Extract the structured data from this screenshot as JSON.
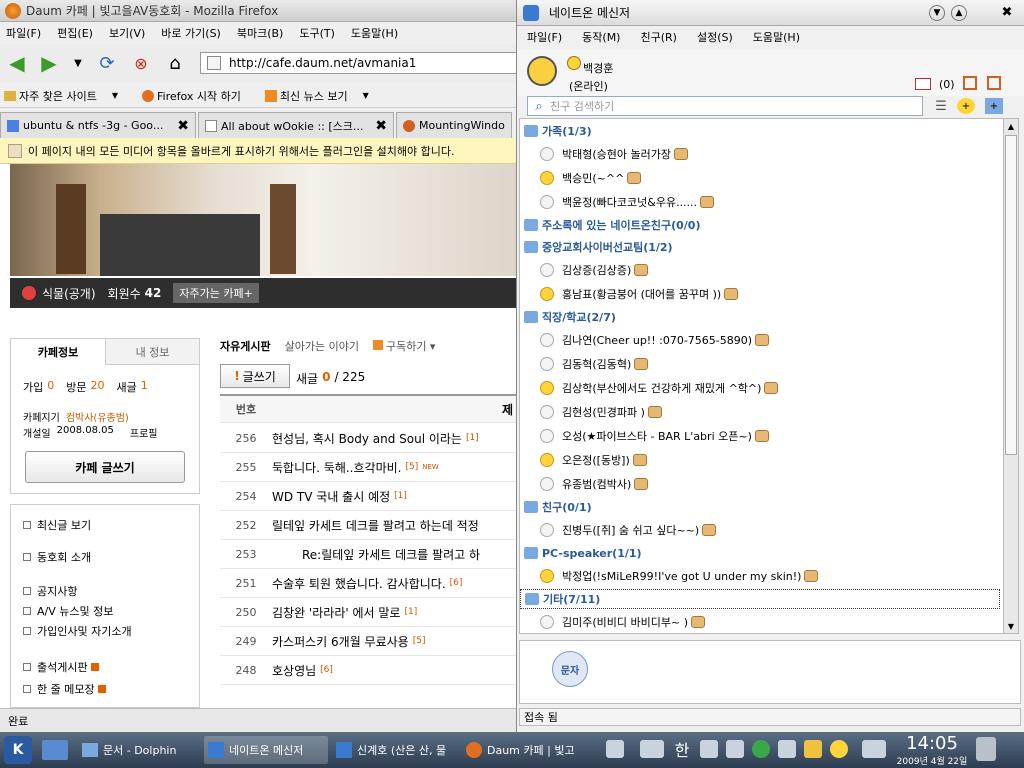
{
  "firefox": {
    "title": "Daum 카페 | 빛고을AV동호회 - Mozilla Firefox",
    "menu": [
      "파일(F)",
      "편집(E)",
      "보기(V)",
      "바로 가기(S)",
      "북마크(B)",
      "도구(T)",
      "도움말(H)"
    ],
    "url": "http://cafe.daum.net/avmania1",
    "bookmarks": [
      "자주 찾은 사이트",
      "Firefox 시작 하기",
      "최신 뉴스 보기"
    ],
    "tabs": [
      "ubuntu & ntfs -3g - Goo...",
      "All about wOokie :: [스크...",
      "MountingWindow"
    ],
    "plugin_notice": "이 페이지 내의 모든 미디어 항목을 올바르게 표시하기 위해서는 플러그인을 설치해야 합니다.",
    "status": "완료"
  },
  "cafe": {
    "level": "식물(공개)",
    "members_label": "회원수",
    "members": "42",
    "fav_button": "자주가는 카페+",
    "info_tab": "카페정보",
    "my_tab": "내 정보",
    "join_label": "가입",
    "join": "0",
    "visit_label": "방문",
    "visit": "20",
    "new_label": "새글",
    "new": "1",
    "manager_label": "카페지기",
    "manager": "컴박사(유종범)",
    "opened_label": "개설일",
    "opened": "2008.08.05",
    "profile_link": "프로필",
    "write_button": "카페 글쓰기",
    "menu": [
      "최신글 보기",
      "동호회 소개",
      "공지사항",
      "A/V 뉴스및 정보",
      "가입인사및 자기소개",
      "출석게시판",
      "한 줄 메모장"
    ]
  },
  "board": {
    "tab_active": "자유게시판",
    "tab_other": "살아가는 이야기",
    "subscribe": "구독하기",
    "write": "글쓰기",
    "count_label": "새글",
    "new": "0",
    "total": "/ 225",
    "col_no": "번호",
    "col_title": "제",
    "posts": [
      {
        "no": "256",
        "title": "현성님, 혹시 Body and Soul 이라는",
        "c": "[1]"
      },
      {
        "no": "255",
        "title": "둑합니다. 둑해..흐각마비.",
        "c": "[5]",
        "n": "NEW"
      },
      {
        "no": "254",
        "title": "WD TV 국내 출시 예정",
        "c": "[1]"
      },
      {
        "no": "252",
        "title": "릴테잎 카세트 데크를 팔려고 하는데 적정",
        "c": ""
      },
      {
        "no": "253",
        "title": "Re:릴테잎 카세트 데크를 팔려고 하",
        "c": ""
      },
      {
        "no": "251",
        "title": "수술후 퇴원 했습니다. 감사합니다.",
        "c": "[6]"
      },
      {
        "no": "250",
        "title": "김창완 '라라라' 에서 말로",
        "c": "[1]"
      },
      {
        "no": "249",
        "title": "카스퍼스키 6개월 무료사용",
        "c": "[5]"
      },
      {
        "no": "248",
        "title": "호상영님",
        "c": "[6]"
      }
    ]
  },
  "messenger": {
    "title": "네이트온 메신저",
    "menu": [
      "파일(F)",
      "동작(M)",
      "친구(R)",
      "설정(S)",
      "도움말(H)"
    ],
    "name": "백경훈",
    "status": "(온라인)",
    "mail": "(0)",
    "search_ph": "친구 검색하기",
    "items": [
      {
        "t": "g",
        "text": "가족(1/3)"
      },
      {
        "t": "f",
        "text": "박태형(승현아 놀러가장",
        "on": false
      },
      {
        "t": "f",
        "text": "백승민(~^^",
        "on": true
      },
      {
        "t": "f",
        "text": "백윤정(빠다코코넛&우유......",
        "on": false
      },
      {
        "t": "g",
        "text": "주소록에 있는 네이트온친구(0/0)"
      },
      {
        "t": "g",
        "text": "중앙교회사이버선교팀(1/2)"
      },
      {
        "t": "f",
        "text": "김상증(김상증)",
        "on": false
      },
      {
        "t": "f",
        "text": "홍남표(황금붕어 (대어를 꿈꾸며 ))",
        "on": true
      },
      {
        "t": "g",
        "text": "직장/학교(2/7)"
      },
      {
        "t": "f",
        "text": "김나연(Cheer up!! :070-7565-5890)",
        "on": false
      },
      {
        "t": "f",
        "text": "김동혁(김동혁)",
        "on": false
      },
      {
        "t": "f",
        "text": "김상학(부산에서도 건강하게 재밌게 ^학^)",
        "on": true
      },
      {
        "t": "f",
        "text": "김현성(민경파파 )",
        "on": false
      },
      {
        "t": "f",
        "text": "오성(★파이브스타 - BAR L'abri 오픈~)",
        "on": false
      },
      {
        "t": "f",
        "text": "오은정([동방])",
        "on": true
      },
      {
        "t": "f",
        "text": "유종범(컴박사)",
        "on": false
      },
      {
        "t": "g",
        "text": "친구(0/1)"
      },
      {
        "t": "f",
        "text": "진병두([쥐] 숨 쉬고 싶다~~)",
        "on": false
      },
      {
        "t": "g",
        "text": "PC-speaker(1/1)"
      },
      {
        "t": "f",
        "text": "박정업(!sMiLeR99!I've got U under my skin!)",
        "on": true
      },
      {
        "t": "g",
        "text": "기타(7/11)",
        "sel": true
      },
      {
        "t": "f",
        "text": "김미주(비비디 바비디부~ )",
        "on": false
      }
    ],
    "bottom_status": "접속 됨",
    "sms": "문자"
  },
  "taskbar": {
    "tasks": [
      "문서 - Dolphin",
      "네이트온 메신저",
      "신계호 (산은 산, 물",
      "Daum 카페 | 빛고"
    ],
    "lang": "한",
    "time": "14:05",
    "date": "2009년 4월 22일"
  },
  "colors": {
    "accent": "#2a5a9a",
    "taskbar": "#34465c",
    "online": "#ffd43a"
  }
}
